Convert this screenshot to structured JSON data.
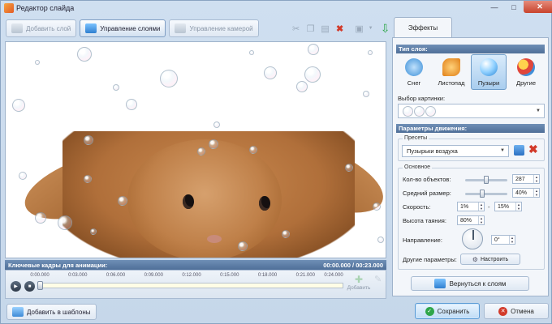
{
  "window": {
    "title": "Редактор слайда"
  },
  "toolbar": {
    "add_layer": "Добавить слой",
    "manage_layers": "Управление слоями",
    "manage_camera": "Управление камерой"
  },
  "timeline": {
    "header": "Ключевые кадры для анимации:",
    "time": "00:00.000 / 00:23.000",
    "ticks": [
      "0:00.000",
      "0:03.000",
      "0:06.000",
      "0:09.000",
      "0:12.000",
      "0:15.000",
      "0:18.000",
      "0:21.000",
      "0:24.000"
    ],
    "add_label": "Добавить"
  },
  "bottom": {
    "add_template": "Добавить в шаблоны",
    "save": "Сохранить",
    "cancel": "Отмена"
  },
  "panel": {
    "tab": "Эффекты",
    "layer_type_header": "Тип слоя:",
    "types": [
      {
        "label": "Снег",
        "icon": "snowflake-icon",
        "color": "#5ba7e6"
      },
      {
        "label": "Листопад",
        "icon": "leaf-icon",
        "color": "#e89a2a"
      },
      {
        "label": "Пузыри",
        "icon": "bubble-icon",
        "color": "#69b7f0"
      },
      {
        "label": "Другие",
        "icon": "hearts-icon",
        "color": "#e0463b"
      }
    ],
    "selected_type": "Пузыри",
    "image_choice_label": "Выбор картинки:",
    "motion_header": "Параметры движения:",
    "presets_title": "Пресеты",
    "preset_value": "Пузырьки воздуха",
    "basic_title": "Основное",
    "count_label": "Кол-во объектов:",
    "count_value": "287",
    "count_fraction": 0.5,
    "size_label": "Средний размер:",
    "size_value": "40%",
    "size_fraction": 0.4,
    "speed_label": "Скорость:",
    "speed_from": "1%",
    "speed_dash": "-",
    "speed_to": "15%",
    "melt_label": "Высота таяния:",
    "melt_value": "80%",
    "direction_label": "Направление:",
    "direction_value": "0°",
    "other_label": "Другие параметры:",
    "configure": "Настроить",
    "back": "Вернуться к слоям"
  }
}
